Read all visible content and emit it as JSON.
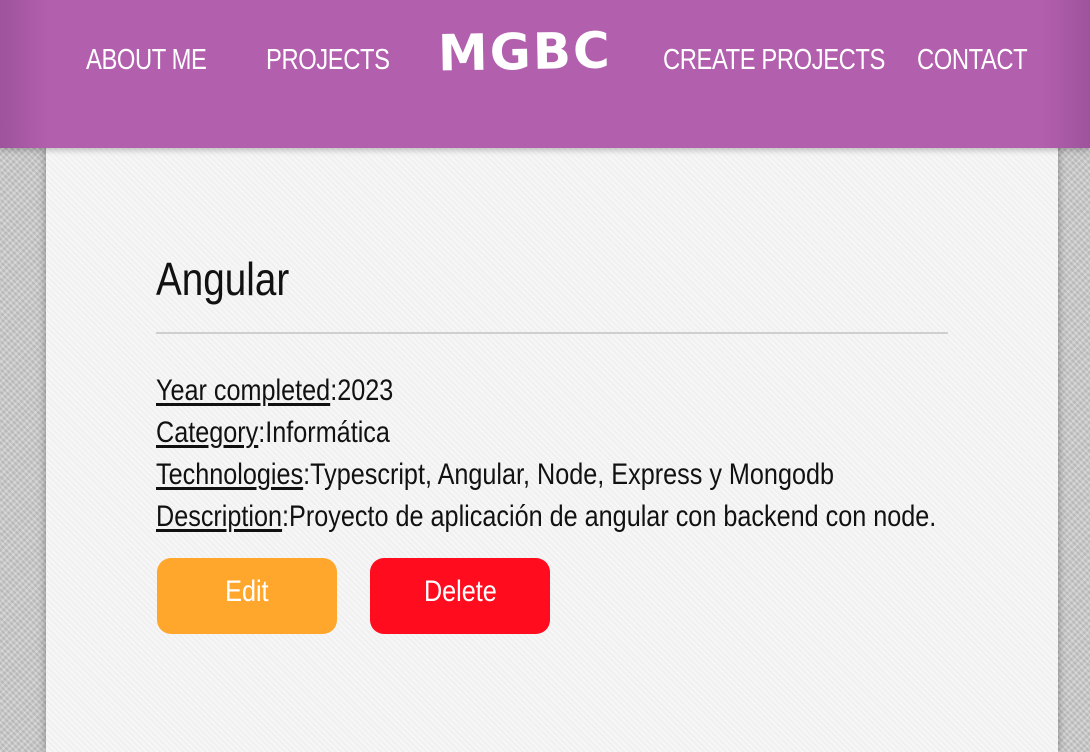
{
  "nav": {
    "about_label": "ABOUT ME",
    "projects_label": "PROJECTS",
    "logo_text": "MGBC",
    "create_label": "CREATE PROJECTS",
    "contact_label": "CONTACT"
  },
  "project": {
    "title": "Angular",
    "year_label": "Year completed",
    "year_value": "2023",
    "category_label": "Category",
    "category_value": "Informática",
    "technologies_label": "Technologies",
    "technologies_value": "Typescript, Angular, Node, Express y Mongodb",
    "description_label": "Description",
    "description_value": "Proyecto de aplicación de angular con backend con node."
  },
  "actions": {
    "edit_label": "Edit",
    "delete_label": "Delete"
  },
  "colors": {
    "header_bg": "#b25fae",
    "edit_button": "#ffa72c",
    "delete_button": "#ff0d1e"
  }
}
